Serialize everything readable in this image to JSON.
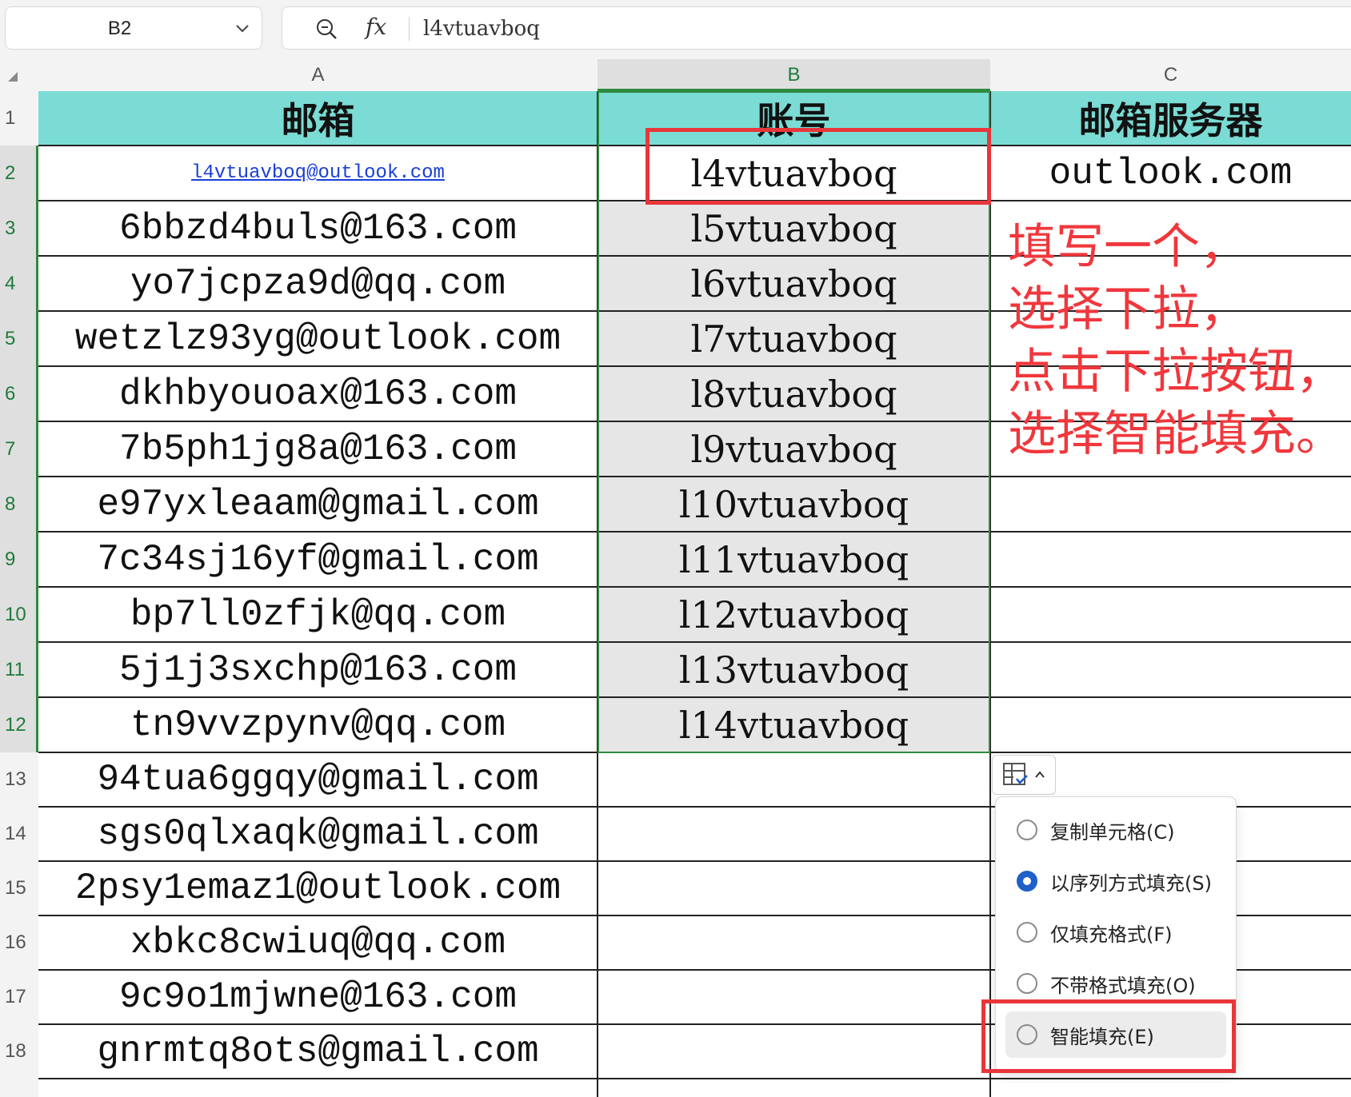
{
  "name_box": "B2",
  "formula": {
    "value": "l4vtuavboq"
  },
  "columns": [
    "A",
    "B",
    "C"
  ],
  "rows": [
    "1",
    "2",
    "3",
    "4",
    "5",
    "6",
    "7",
    "8",
    "9",
    "10",
    "11",
    "12",
    "13",
    "14",
    "15",
    "16",
    "17",
    "18"
  ],
  "headers": {
    "a": "邮箱",
    "b": "账号",
    "c": "邮箱服务器"
  },
  "row2": {
    "a": "l4vtuavboq@outlook.com",
    "b": "l4vtuavboq",
    "c": "outlook.com"
  },
  "col_a": [
    "6bbzd4buls@163.com",
    "yo7jcpza9d@qq.com",
    "wetzlz93yg@outlook.com",
    "dkhbyouoax@163.com",
    "7b5ph1jg8a@163.com",
    "e97yxleaam@gmail.com",
    "7c34sj16yf@gmail.com",
    "bp7ll0zfjk@qq.com",
    "5j1j3sxchp@163.com",
    "tn9vvzpynv@qq.com",
    "94tua6ggqy@gmail.com",
    "sgs0qlxaqk@gmail.com",
    "2psy1emaz1@outlook.com",
    "xbkc8cwiuq@qq.com",
    "9c9o1mjwne@163.com",
    "gnrmtq8ots@gmail.com"
  ],
  "col_b": [
    "l5vtuavboq",
    "l6vtuavboq",
    "l7vtuavboq",
    "l8vtuavboq",
    "l9vtuavboq",
    "l10vtuavboq",
    "l11vtuavboq",
    "l12vtuavboq",
    "l13vtuavboq",
    "l14vtuavboq"
  ],
  "annotation": [
    "填写一个，",
    "选择下拉，",
    "点击下拉按钮，",
    "选择智能填充。"
  ],
  "autofill_menu": [
    {
      "label": "复制单元格(C)",
      "checked": false
    },
    {
      "label": "以序列方式填充(S)",
      "checked": true
    },
    {
      "label": "仅填充格式(F)",
      "checked": false
    },
    {
      "label": "不带格式填充(O)",
      "checked": false
    },
    {
      "label": "智能填充(E)",
      "checked": false
    }
  ],
  "colors": {
    "header_fill": "#7adcd4",
    "selection": "#2e8b3d",
    "annotation": "#f0373c",
    "radio_checked": "#1e5fc8"
  }
}
